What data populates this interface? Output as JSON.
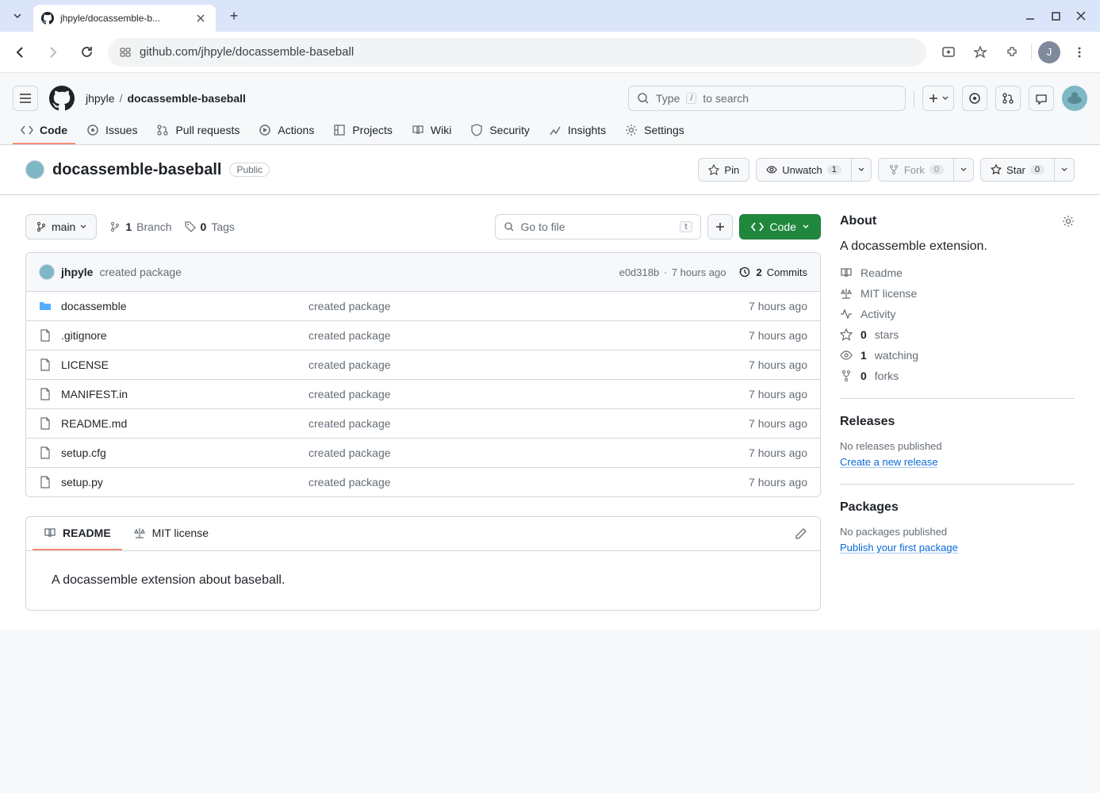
{
  "browser": {
    "tab_title": "jhpyle/docassemble-b...",
    "url": "github.com/jhpyle/docassemble-baseball",
    "avatar_letter": "J"
  },
  "header": {
    "owner": "jhpyle",
    "separator": "/",
    "repo": "docassemble-baseball",
    "search_prefix": "Type",
    "search_key": "/",
    "search_suffix": "to search"
  },
  "nav": {
    "code": "Code",
    "issues": "Issues",
    "pulls": "Pull requests",
    "actions": "Actions",
    "projects": "Projects",
    "wiki": "Wiki",
    "security": "Security",
    "insights": "Insights",
    "settings": "Settings"
  },
  "repo_head": {
    "title": "docassemble-baseball",
    "badge": "Public",
    "pin": "Pin",
    "unwatch": "Unwatch",
    "watch_count": "1",
    "fork": "Fork",
    "fork_count": "0",
    "star": "Star",
    "star_count": "0"
  },
  "file_nav": {
    "branch": "main",
    "branch_count": "1",
    "branch_label": "Branch",
    "tag_count": "0",
    "tag_label": "Tags",
    "goto_placeholder": "Go to file",
    "goto_key": "t",
    "code_btn": "Code"
  },
  "commit_head": {
    "author": "jhpyle",
    "message": "created package",
    "sha": "e0d318b",
    "time": "7 hours ago",
    "sep": "·",
    "commits_count": "2",
    "commits_label": "Commits"
  },
  "files": [
    {
      "name": "docassemble",
      "type": "folder",
      "msg": "created package",
      "time": "7 hours ago"
    },
    {
      "name": ".gitignore",
      "type": "file",
      "msg": "created package",
      "time": "7 hours ago"
    },
    {
      "name": "LICENSE",
      "type": "file",
      "msg": "created package",
      "time": "7 hours ago"
    },
    {
      "name": "MANIFEST.in",
      "type": "file",
      "msg": "created package",
      "time": "7 hours ago"
    },
    {
      "name": "README.md",
      "type": "file",
      "msg": "created package",
      "time": "7 hours ago"
    },
    {
      "name": "setup.cfg",
      "type": "file",
      "msg": "created package",
      "time": "7 hours ago"
    },
    {
      "name": "setup.py",
      "type": "file",
      "msg": "created package",
      "time": "7 hours ago"
    }
  ],
  "readme": {
    "tab_readme": "README",
    "tab_license": "MIT license",
    "content": "A docassemble extension about baseball."
  },
  "sidebar": {
    "about_title": "About",
    "about_desc": "A docassemble extension.",
    "readme": "Readme",
    "license": "MIT license",
    "activity": "Activity",
    "stars_count": "0",
    "stars_label": "stars",
    "watching_count": "1",
    "watching_label": "watching",
    "forks_count": "0",
    "forks_label": "forks",
    "releases_title": "Releases",
    "releases_empty": "No releases published",
    "releases_link": "Create a new release",
    "packages_title": "Packages",
    "packages_empty": "No packages published",
    "packages_link": "Publish your first package"
  }
}
